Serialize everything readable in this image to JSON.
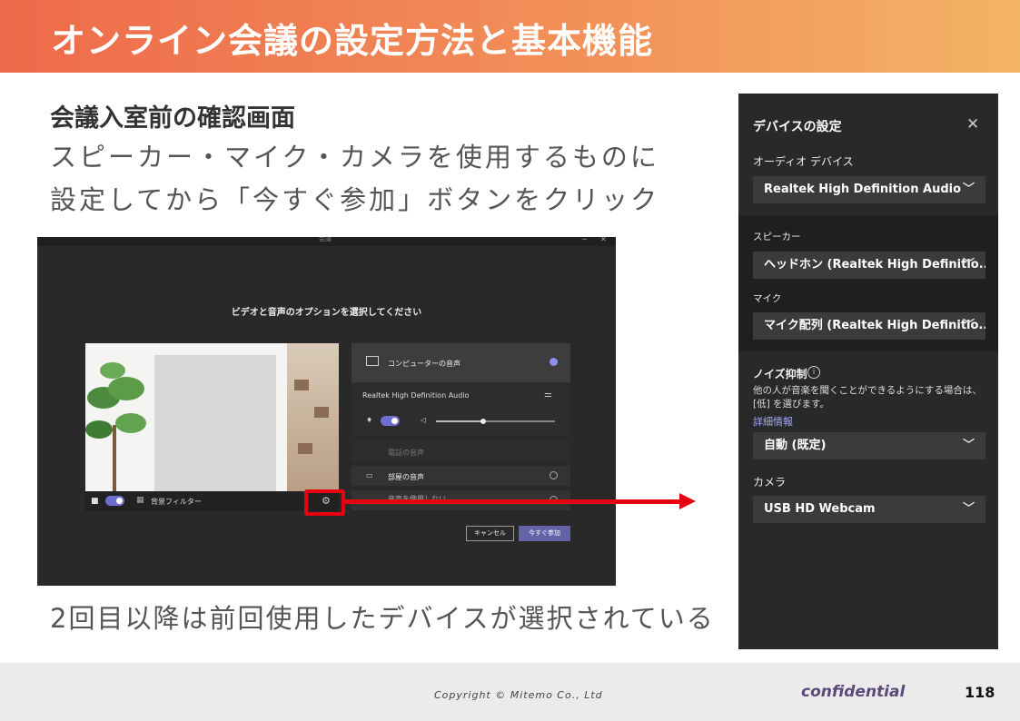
{
  "slide": {
    "title": "オンライン会議の設定方法と基本機能",
    "subtitle": "会議入室前の確認画面",
    "body_line1": "スピーカー・マイク・カメラを使用するものに",
    "body_line2": "設定してから「今すぐ参加」ボタンをクリック",
    "note": "2回目以降は前回使用したデバイスが選択されている"
  },
  "teams": {
    "heading": "ビデオと音声のオプションを選択してください",
    "window_title": "会議",
    "background_filter_label": "背景フィルター",
    "computer_audio_label": "コンピューターの音声",
    "device_name": "Realtek High Definition Audio",
    "phone_audio_label": "電話の音声",
    "room_audio_label": "部屋の音声",
    "no_audio_label": "音声を使用しない",
    "volume_fraction": 0.4,
    "cancel_label": "キャンセル",
    "join_label": "今すぐ参加"
  },
  "device_settings": {
    "title": "デバイスの設定",
    "audio_device_label": "オーディオ デバイス",
    "audio_device_value": "Realtek High Definition Audio",
    "speaker_label": "スピーカー",
    "speaker_value": "ヘッドホン (Realtek High Definitio...",
    "mic_label": "マイク",
    "mic_value": "マイク配列 (Realtek High Definitio...",
    "noise_label": "ノイズ抑制",
    "noise_desc": "他の人が音楽を聞くことができるようにする場合は、[低] を選びます。",
    "details_link": "詳細情報",
    "noise_value": "自動 (既定)",
    "camera_label": "カメラ",
    "camera_value": "USB HD Webcam"
  },
  "footer": {
    "copyright": "Copyright © Mitemo Co., Ltd",
    "confidential": "confidential",
    "page_number": "118"
  },
  "colors": {
    "accent_red": "#e60012",
    "teams_purple": "#6264a7"
  }
}
